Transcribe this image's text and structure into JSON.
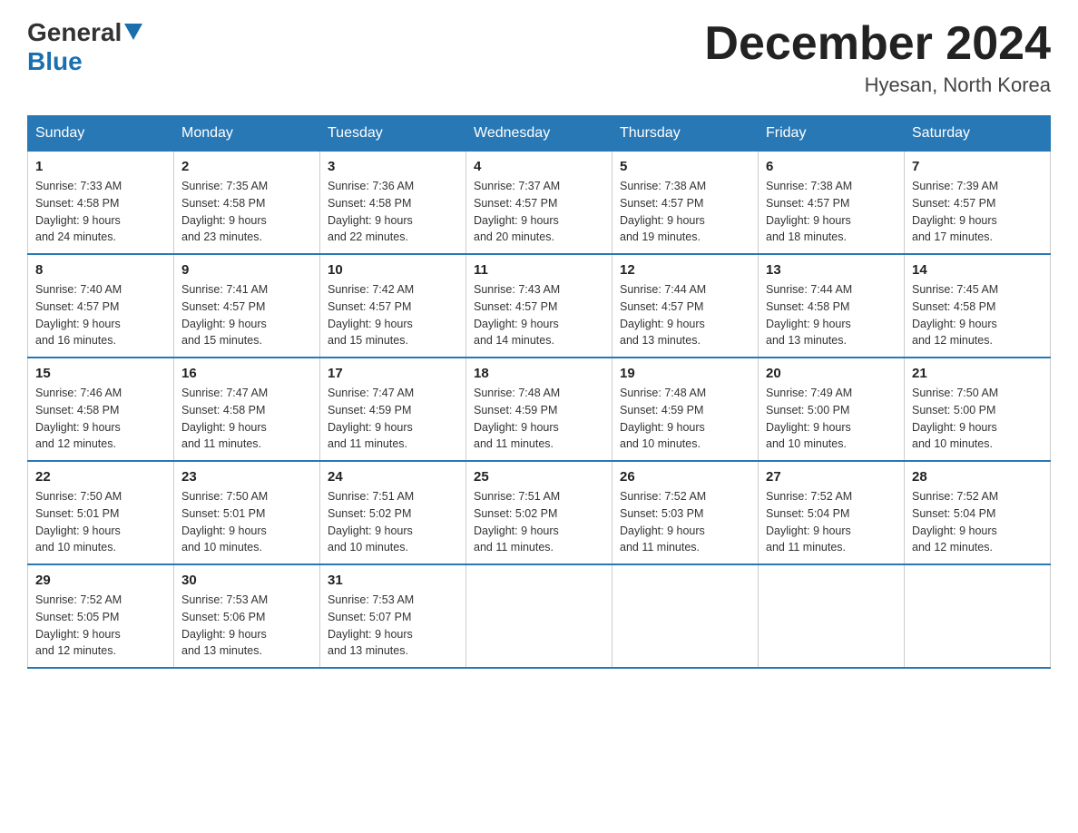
{
  "header": {
    "logo": {
      "text_general": "General",
      "text_blue": "Blue",
      "arrow_color": "#1a6faf"
    },
    "title": "December 2024",
    "subtitle": "Hyesan, North Korea"
  },
  "calendar": {
    "days_of_week": [
      "Sunday",
      "Monday",
      "Tuesday",
      "Wednesday",
      "Thursday",
      "Friday",
      "Saturday"
    ],
    "weeks": [
      [
        {
          "day": "1",
          "sunrise": "7:33 AM",
          "sunset": "4:58 PM",
          "daylight": "9 hours and 24 minutes."
        },
        {
          "day": "2",
          "sunrise": "7:35 AM",
          "sunset": "4:58 PM",
          "daylight": "9 hours and 23 minutes."
        },
        {
          "day": "3",
          "sunrise": "7:36 AM",
          "sunset": "4:58 PM",
          "daylight": "9 hours and 22 minutes."
        },
        {
          "day": "4",
          "sunrise": "7:37 AM",
          "sunset": "4:57 PM",
          "daylight": "9 hours and 20 minutes."
        },
        {
          "day": "5",
          "sunrise": "7:38 AM",
          "sunset": "4:57 PM",
          "daylight": "9 hours and 19 minutes."
        },
        {
          "day": "6",
          "sunrise": "7:38 AM",
          "sunset": "4:57 PM",
          "daylight": "9 hours and 18 minutes."
        },
        {
          "day": "7",
          "sunrise": "7:39 AM",
          "sunset": "4:57 PM",
          "daylight": "9 hours and 17 minutes."
        }
      ],
      [
        {
          "day": "8",
          "sunrise": "7:40 AM",
          "sunset": "4:57 PM",
          "daylight": "9 hours and 16 minutes."
        },
        {
          "day": "9",
          "sunrise": "7:41 AM",
          "sunset": "4:57 PM",
          "daylight": "9 hours and 15 minutes."
        },
        {
          "day": "10",
          "sunrise": "7:42 AM",
          "sunset": "4:57 PM",
          "daylight": "9 hours and 15 minutes."
        },
        {
          "day": "11",
          "sunrise": "7:43 AM",
          "sunset": "4:57 PM",
          "daylight": "9 hours and 14 minutes."
        },
        {
          "day": "12",
          "sunrise": "7:44 AM",
          "sunset": "4:57 PM",
          "daylight": "9 hours and 13 minutes."
        },
        {
          "day": "13",
          "sunrise": "7:44 AM",
          "sunset": "4:58 PM",
          "daylight": "9 hours and 13 minutes."
        },
        {
          "day": "14",
          "sunrise": "7:45 AM",
          "sunset": "4:58 PM",
          "daylight": "9 hours and 12 minutes."
        }
      ],
      [
        {
          "day": "15",
          "sunrise": "7:46 AM",
          "sunset": "4:58 PM",
          "daylight": "9 hours and 12 minutes."
        },
        {
          "day": "16",
          "sunrise": "7:47 AM",
          "sunset": "4:58 PM",
          "daylight": "9 hours and 11 minutes."
        },
        {
          "day": "17",
          "sunrise": "7:47 AM",
          "sunset": "4:59 PM",
          "daylight": "9 hours and 11 minutes."
        },
        {
          "day": "18",
          "sunrise": "7:48 AM",
          "sunset": "4:59 PM",
          "daylight": "9 hours and 11 minutes."
        },
        {
          "day": "19",
          "sunrise": "7:48 AM",
          "sunset": "4:59 PM",
          "daylight": "9 hours and 10 minutes."
        },
        {
          "day": "20",
          "sunrise": "7:49 AM",
          "sunset": "5:00 PM",
          "daylight": "9 hours and 10 minutes."
        },
        {
          "day": "21",
          "sunrise": "7:50 AM",
          "sunset": "5:00 PM",
          "daylight": "9 hours and 10 minutes."
        }
      ],
      [
        {
          "day": "22",
          "sunrise": "7:50 AM",
          "sunset": "5:01 PM",
          "daylight": "9 hours and 10 minutes."
        },
        {
          "day": "23",
          "sunrise": "7:50 AM",
          "sunset": "5:01 PM",
          "daylight": "9 hours and 10 minutes."
        },
        {
          "day": "24",
          "sunrise": "7:51 AM",
          "sunset": "5:02 PM",
          "daylight": "9 hours and 10 minutes."
        },
        {
          "day": "25",
          "sunrise": "7:51 AM",
          "sunset": "5:02 PM",
          "daylight": "9 hours and 11 minutes."
        },
        {
          "day": "26",
          "sunrise": "7:52 AM",
          "sunset": "5:03 PM",
          "daylight": "9 hours and 11 minutes."
        },
        {
          "day": "27",
          "sunrise": "7:52 AM",
          "sunset": "5:04 PM",
          "daylight": "9 hours and 11 minutes."
        },
        {
          "day": "28",
          "sunrise": "7:52 AM",
          "sunset": "5:04 PM",
          "daylight": "9 hours and 12 minutes."
        }
      ],
      [
        {
          "day": "29",
          "sunrise": "7:52 AM",
          "sunset": "5:05 PM",
          "daylight": "9 hours and 12 minutes."
        },
        {
          "day": "30",
          "sunrise": "7:53 AM",
          "sunset": "5:06 PM",
          "daylight": "9 hours and 13 minutes."
        },
        {
          "day": "31",
          "sunrise": "7:53 AM",
          "sunset": "5:07 PM",
          "daylight": "9 hours and 13 minutes."
        },
        null,
        null,
        null,
        null
      ]
    ]
  }
}
